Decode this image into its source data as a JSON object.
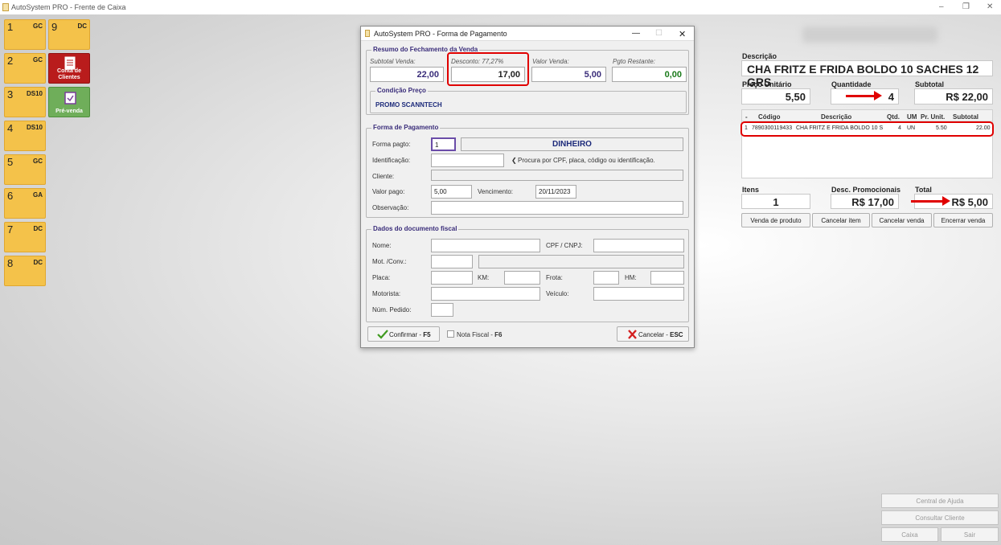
{
  "app": {
    "title": "AutoSystem PRO - Frente de Caixa",
    "min": "–",
    "restore": "❐",
    "close": "✕"
  },
  "tiles": [
    {
      "num": "1",
      "code": "GC"
    },
    {
      "num": "9",
      "code": "DC"
    },
    {
      "num": "2",
      "code": "GC"
    },
    {
      "label": "Conta de Clientes"
    },
    {
      "num": "3",
      "code": "DS10"
    },
    {
      "label": "Pré-venda"
    },
    {
      "num": "4",
      "code": "DS10"
    },
    {
      "num": "5",
      "code": "GC"
    },
    {
      "num": "6",
      "code": "GA"
    },
    {
      "num": "7",
      "code": "DC"
    },
    {
      "num": "8",
      "code": "DC"
    }
  ],
  "dialog": {
    "title": "AutoSystem PRO - Forma de Pagamento",
    "min": "—",
    "max": "☐",
    "close": "✕",
    "resumo": {
      "title": "Resumo do Fechamento da Venda",
      "subtotal_label": "Subtotal Venda:",
      "subtotal": "22,00",
      "desconto_label": "Desconto: 77,27%",
      "desconto": "17,00",
      "valor_label": "Valor Venda:",
      "valor": "5,00",
      "restante_label": "Pgto Restante:",
      "restante": "0,00"
    },
    "condicao": {
      "title": "Condição Preço",
      "value": "PROMO SCANNTECH"
    },
    "pagamento": {
      "title": "Forma de Pagamento",
      "forma_label": "Forma pagto:",
      "forma_code": "1",
      "forma_name": "DINHEIRO",
      "ident_label": "Identificação:",
      "ident_hint": "Procura por CPF, placa, código ou identificação.",
      "cliente_label": "Cliente:",
      "valor_pago_label": "Valor pago:",
      "valor_pago": "5,00",
      "venc_label": "Vencimento:",
      "vencimento": "20/11/2023",
      "obs_label": "Observação:"
    },
    "fiscal": {
      "title": "Dados do documento fiscal",
      "nome": "Nome:",
      "cpf": "CPF / CNPJ:",
      "mot": "Mot. /Conv.:",
      "placa": "Placa:",
      "km": "KM:",
      "frota": "Frota:",
      "hm": "HM:",
      "motorista": "Motorista:",
      "veiculo": "Veículo:",
      "pedido": "Núm. Pedido:"
    },
    "confirmar": "Confirmar - ",
    "confirmar_key": "F5",
    "nota": "Nota Fiscal - ",
    "nota_key": "F6",
    "cancelar": "Cancelar - ",
    "cancelar_key": "ESC"
  },
  "right": {
    "descricao_label": "Descrição",
    "descricao": "CHA FRITZ E FRIDA BOLDO 10 SACHES 12 GRS",
    "preco_label": "Preço Unitário",
    "preco": "5,50",
    "qtd_label": "Quantidade",
    "qtd": "4",
    "subtotal_label": "Subtotal",
    "subtotal": "R$ 22,00",
    "grid": {
      "headers": [
        "-",
        "Código",
        "Descrição",
        "Qtd.",
        "UM",
        "Pr. Unit.",
        "Subtotal"
      ],
      "row": [
        "1",
        "7890300119433",
        "CHA FRITZ E FRIDA BOLDO 10 S",
        "4",
        "UN",
        "5.50",
        "22.00"
      ]
    },
    "itens_label": "Itens",
    "itens": "1",
    "desc_label": "Desc. Promocionais",
    "desc": "R$ 17,00",
    "total_label": "Total",
    "total": "R$ 5,00",
    "btn_venda": "Venda de produto",
    "btn_cancel_item": "Cancelar item",
    "btn_cancel_venda": "Cancelar venda",
    "btn_encerrar": "Encerrar venda"
  },
  "bottom": {
    "ajuda": "Central de Ajuda",
    "consultar": "Consultar Cliente",
    "caixa": "Caixa",
    "sair": "Sair"
  },
  "colors": {
    "highlight": "#e00000",
    "tile": "#f4c24a",
    "red_tile": "#b91c1c",
    "green_tile": "#6fae5a",
    "accent_text": "#3a2d7a"
  }
}
